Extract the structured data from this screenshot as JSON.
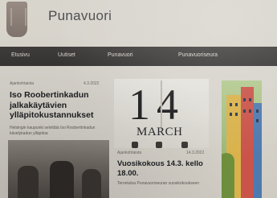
{
  "site": {
    "title": "Punavuori"
  },
  "nav": {
    "items": [
      {
        "label": "Etusivu"
      },
      {
        "label": "Uutiset"
      },
      {
        "label": "Punavuori"
      },
      {
        "label": "Punavuoriseura"
      }
    ]
  },
  "articles": [
    {
      "tag": "Ajankohtaista",
      "date": "4.3.2022",
      "title": "Iso Roobertinkadun jalkakäytävien ylläpitokustannukset",
      "excerpt": "Helsingin kaupunki selvittää Iso Roobertinkadun kävelykadun ylläpitoa"
    },
    {
      "tag": "Ajankohtaista",
      "date": "14.3.2022",
      "title": "Vuosikokous 14.3. kello 18.00.",
      "excerpt": "Tervetuloa Punavuoriseuran vuosikokoukseen"
    }
  ],
  "calendar_image": {
    "day": "14",
    "month": "MARCH"
  },
  "colors": {
    "nav_background": "#3a3837",
    "nav_text": "#dcd8d2",
    "page_background": "#d6d3cb",
    "title_text": "#202024"
  }
}
